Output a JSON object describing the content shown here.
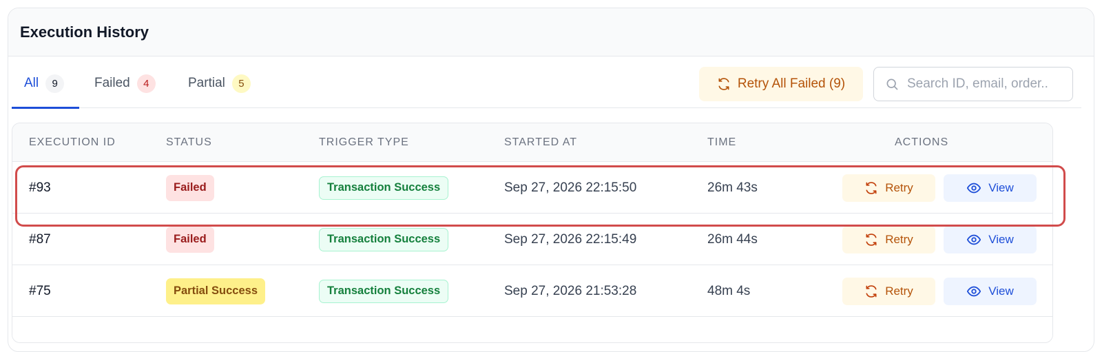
{
  "header": {
    "title": "Execution History"
  },
  "tabs": [
    {
      "label": "All",
      "count": "9"
    },
    {
      "label": "Failed",
      "count": "4"
    },
    {
      "label": "Partial",
      "count": "5"
    }
  ],
  "toolbar": {
    "retry_all_label": "Retry All Failed (9)"
  },
  "search": {
    "placeholder": "Search ID, email, order..",
    "value": ""
  },
  "table": {
    "columns": [
      "EXECUTION ID",
      "STATUS",
      "TRIGGER TYPE",
      "STARTED AT",
      "TIME",
      "ACTIONS"
    ],
    "rows": [
      {
        "id": "#93",
        "status": "Failed",
        "trigger": "Transaction Success",
        "started_at": "Sep 27, 2026 22:15:50",
        "time": "26m 43s",
        "retry_label": "Retry",
        "view_label": "View"
      },
      {
        "id": "#87",
        "status": "Failed",
        "trigger": "Transaction Success",
        "started_at": "Sep 27, 2026 22:15:49",
        "time": "26m 44s",
        "retry_label": "Retry",
        "view_label": "View"
      },
      {
        "id": "#75",
        "status": "Partial Success",
        "trigger": "Transaction Success",
        "started_at": "Sep 27, 2026 21:53:28",
        "time": "48m 4s",
        "retry_label": "Retry",
        "view_label": "View"
      }
    ]
  },
  "icons": {
    "retry": "refresh-icon",
    "search": "search-icon",
    "view": "eye-icon"
  },
  "colors": {
    "accent": "#1d4ed8",
    "failed": "#991b1b",
    "partial": "#854d0e",
    "success": "#15803d",
    "retry": "#b45309",
    "highlight": "#d14b4b"
  }
}
